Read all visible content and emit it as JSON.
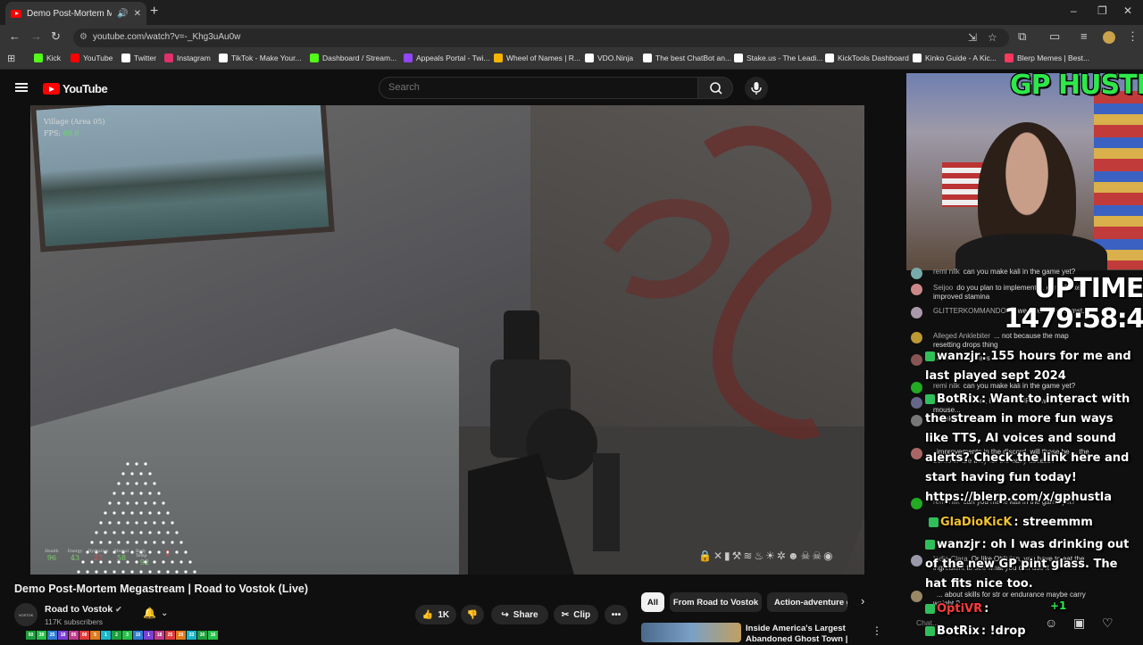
{
  "browser": {
    "tab_title": "Demo Post-Mortem Megastream",
    "url": "youtube.com/watch?v=-_Khg3uAu0w",
    "bookmarks": [
      {
        "label": "Kick",
        "color": "#53fc18"
      },
      {
        "label": "YouTube",
        "color": "#ff0000"
      },
      {
        "label": "Twitter",
        "color": "#ffffff"
      },
      {
        "label": "Instagram",
        "color": "#e1306c"
      },
      {
        "label": "TikTok - Make Your...",
        "color": "#ffffff"
      },
      {
        "label": "Dashboard / Stream...",
        "color": "#53fc18"
      },
      {
        "label": "Appeals Portal - Twi...",
        "color": "#9146ff"
      },
      {
        "label": "Wheel of Names | R...",
        "color": "#f4b400"
      },
      {
        "label": "VDO.Ninja",
        "color": "#ffffff"
      },
      {
        "label": "The best ChatBot an...",
        "color": "#ffffff"
      },
      {
        "label": "Stake.us - The Leadi...",
        "color": "#ffffff"
      },
      {
        "label": "KickTools Dashboard",
        "color": "#ffffff"
      },
      {
        "label": "Kinko Guide - A Kic...",
        "color": "#ffffff"
      },
      {
        "label": "Blerp Memes | Best...",
        "color": "#ff3860"
      }
    ]
  },
  "youtube": {
    "logo_text": "YouTube",
    "search_placeholder": "Search"
  },
  "video": {
    "location": "Village (Area 05)",
    "fps_label": "FPS:",
    "fps_value": "60.0",
    "stats": [
      {
        "label": "Health",
        "value": "96"
      },
      {
        "label": "Energy",
        "value": "43"
      },
      {
        "label": "Hydration",
        "value": "27"
      },
      {
        "label": "Mental",
        "value": "58"
      },
      {
        "label": "Body Temp",
        "value": "92"
      },
      {
        "label": "",
        "value": "2"
      }
    ],
    "title": "Demo Post-Mortem Megastream | Road to Vostok (Live)",
    "channel": "Road to Vostok",
    "subscribers": "117K subscribers",
    "likes": "1K",
    "share_label": "Share",
    "clip_label": "Clip"
  },
  "related": {
    "chips": [
      "All",
      "From Road to Vostok",
      "Action-adventure games"
    ],
    "first_title": "Inside America's Largest Abandoned Ghost Town |"
  },
  "overlay": {
    "brand": "GP HUSTLA",
    "uptime_label": "UPTIME",
    "uptime_value": "1479:58:45"
  },
  "yt_chat": [
    {
      "author": "remi nilk",
      "text": "can you make kali in the game yet?"
    },
    {
      "author": "Seijoo",
      "text": "do you plan to implement ... game? like improved stamina"
    },
    {
      "author": "GLITTERKOMMANDO",
      "text": "... weapons in circumst..."
    },
    {
      "author": "Alleged Anklebiter",
      "text": "... not because the map resetting drops thing"
    },
    {
      "author": "",
      "text": "kinda usefulness"
    },
    {
      "author": "remi nilk",
      "text": "can you make kali in the game yet?"
    },
    {
      "author": "",
      "text": "loot a container, it reads EMPTY when you mouse..."
    },
    {
      "author": "",
      "text": "book"
    },
    {
      "author": "",
      "text": "improvements in the discord. will these be ... the demo or are they for the early access?"
    },
    {
      "author": "remi nilk",
      "text": "can you make kali in the game yet?"
    },
    {
      "author": "Indie Clara",
      "text": "Or like Oblivion, you have to eat the ingredient to see what you can use it in"
    },
    {
      "author": "",
      "text": "... about skills for str or endurance maybe carry weight ?"
    }
  ],
  "kick_chat": [
    {
      "name": "wanzjr",
      "color": "#ffffff",
      "text": ": 155 hours for me and last played sept 2024"
    },
    {
      "name": "BotRix",
      "color": "#ffffff",
      "text": ": Want to interact with the stream in more fun ways like TTS, AI voices and sound alerts? Check the link here and start having fun today! https://blerp.com/x/gphustla"
    },
    {
      "name": "GlaDioKicK",
      "color": "#f2c230",
      "text": ": streemmm"
    },
    {
      "name": "wanzjr",
      "color": "#ffffff",
      "text": ": oh I was drinking out of the new GP pint glass. The hat fits nice too."
    },
    {
      "name": "OptiVR",
      "color": "#ff3b3b",
      "text": ":"
    },
    {
      "name": "BotRix",
      "color": "#ffffff",
      "text": ": !drop"
    }
  ],
  "kick_extra": {
    "plus_one": "+1"
  },
  "chat_input_placeholder": "Chat...",
  "donation_counts": [
    "50",
    "39",
    "25",
    "18",
    "05",
    "08",
    "5",
    "1",
    "2",
    "3",
    "15",
    "1",
    "18",
    "25",
    "20",
    "33",
    "30",
    "16"
  ],
  "colors": {
    "accent_red": "#ff0000",
    "kick_green": "#53fc18",
    "bg": "#0f0f0f"
  }
}
